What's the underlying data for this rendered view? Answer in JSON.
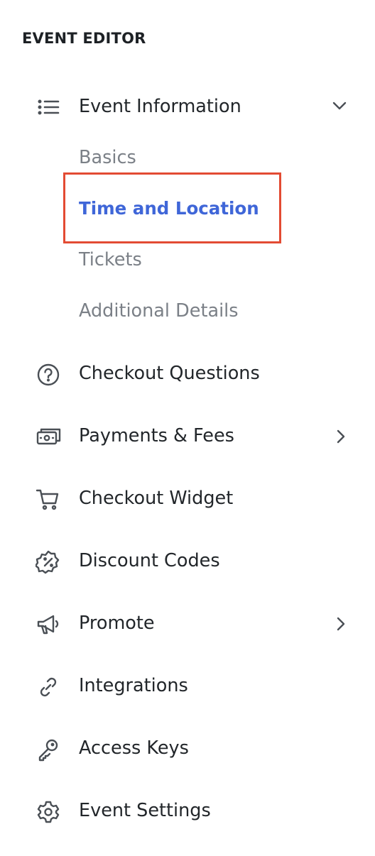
{
  "header": {
    "title": "EVENT EDITOR"
  },
  "colors": {
    "active_link": "#3f66d8",
    "highlight_border": "#e34b33",
    "sub_link": "#7b8087",
    "text": "#22262a",
    "icon": "#4a4f55"
  },
  "nav": {
    "event_information": {
      "label": "Event Information",
      "icon": "list-icon",
      "expanded": true,
      "sub_items": [
        {
          "label": "Basics",
          "active": false
        },
        {
          "label": "Time and Location",
          "active": true
        },
        {
          "label": "Tickets",
          "active": false
        },
        {
          "label": "Additional Details",
          "active": false
        }
      ]
    },
    "items": [
      {
        "label": "Checkout Questions",
        "icon": "question-circle-icon",
        "has_submenu": false
      },
      {
        "label": "Payments & Fees",
        "icon": "cash-icon",
        "has_submenu": true
      },
      {
        "label": "Checkout Widget",
        "icon": "cart-icon",
        "has_submenu": false
      },
      {
        "label": "Discount Codes",
        "icon": "discount-badge-icon",
        "has_submenu": false
      },
      {
        "label": "Promote",
        "icon": "megaphone-icon",
        "has_submenu": true
      },
      {
        "label": "Integrations",
        "icon": "link-icon",
        "has_submenu": false
      },
      {
        "label": "Access Keys",
        "icon": "key-icon",
        "has_submenu": false
      },
      {
        "label": "Event Settings",
        "icon": "gear-icon",
        "has_submenu": false
      }
    ]
  }
}
